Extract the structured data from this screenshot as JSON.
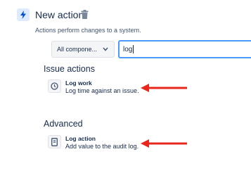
{
  "header": {
    "title": "New action",
    "subtitle": "Actions perform changes to a system.",
    "icon": "lightning-icon"
  },
  "filter": {
    "select_value": "All compone...",
    "search_value": "log"
  },
  "sections": [
    {
      "heading": "Issue actions",
      "items": [
        {
          "title": "Log work",
          "description": "Log time against an issue.",
          "icon": "clock-icon"
        }
      ]
    },
    {
      "heading": "Advanced",
      "items": [
        {
          "title": "Log action",
          "description": "Add value to the audit log.",
          "icon": "document-icon"
        }
      ]
    }
  ],
  "colors": {
    "accent_blue": "#0052cc",
    "focus_border": "#4c9aff",
    "annotation_red": "#e8281c"
  }
}
